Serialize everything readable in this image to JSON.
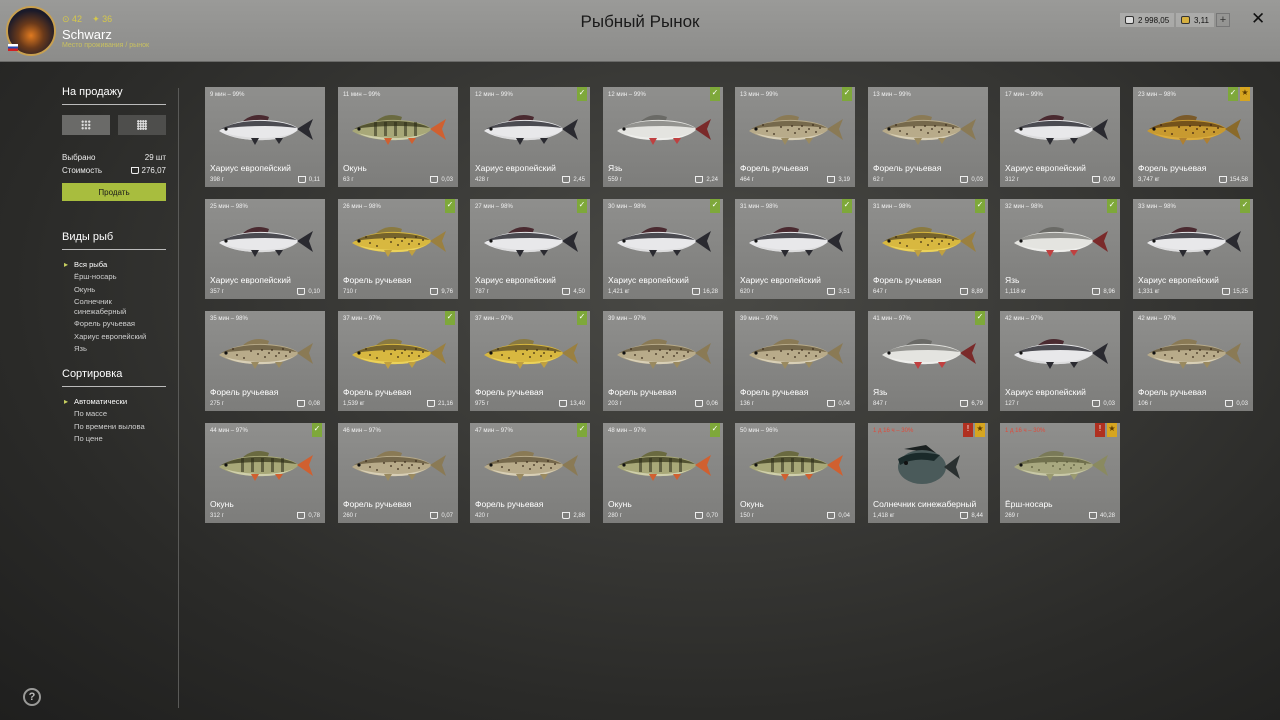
{
  "header": {
    "title": "Рыбный Рынок",
    "stat_level": "42",
    "stat_rank": "36",
    "username": "Schwarz",
    "subline": "Место проживания / рынок",
    "silver": "2 998,05",
    "gold": "3,11",
    "plus": "+",
    "close": "✕"
  },
  "sidebar": {
    "sale_title": "На продажу",
    "selected_label": "Выбрано",
    "selected_value": "29 шт",
    "cost_label": "Стоимость",
    "cost_value": "276,07",
    "sell_label": "Продать",
    "species_title": "Виды рыб",
    "species": [
      "Вся рыба",
      "Ёрш-носарь",
      "Окунь",
      "Солнечник синежаберный",
      "Форель ручьевая",
      "Хариус европейский",
      "Язь"
    ],
    "sort_title": "Сортировка",
    "sorts": [
      "Автоматически",
      "По массе",
      "По времени вылова",
      "По цене"
    ],
    "help": "?"
  },
  "colors": {
    "accent": "#a8bd3e",
    "check_badge": "#7ea83a",
    "star_badge": "#d6a520",
    "warning_badge": "#b03020"
  },
  "cards": [
    {
      "time": "9 мин – 99%",
      "name": "Хариус европейский",
      "weight": "398 г",
      "price": "0,11",
      "badges": [],
      "fish": "grayling"
    },
    {
      "time": "11 мин – 99%",
      "name": "Окунь",
      "weight": "63 г",
      "price": "0,03",
      "badges": [],
      "fish": "perch"
    },
    {
      "time": "12 мин – 99%",
      "name": "Хариус европейский",
      "weight": "428 г",
      "price": "2,45",
      "badges": [
        "check"
      ],
      "fish": "grayling"
    },
    {
      "time": "12 мин – 99%",
      "name": "Язь",
      "weight": "559 г",
      "price": "2,24",
      "badges": [
        "check"
      ],
      "fish": "ide"
    },
    {
      "time": "13 мин – 99%",
      "name": "Форель ручьевая",
      "weight": "464 г",
      "price": "3,19",
      "badges": [
        "check"
      ],
      "fish": "trout"
    },
    {
      "time": "13 мин – 99%",
      "name": "Форель ручьевая",
      "weight": "62 г",
      "price": "0,03",
      "badges": [],
      "fish": "trout"
    },
    {
      "time": "17 мин – 99%",
      "name": "Хариус европейский",
      "weight": "312 г",
      "price": "0,09",
      "badges": [],
      "fish": "grayling"
    },
    {
      "time": "23 мин – 98%",
      "name": "Форель ручьевая",
      "weight": "3,747 кг",
      "price": "154,58",
      "badges": [
        "check",
        "star"
      ],
      "fish": "trout_gold"
    },
    {
      "time": "25 мин – 98%",
      "name": "Хариус европейский",
      "weight": "357 г",
      "price": "0,10",
      "badges": [],
      "fish": "grayling"
    },
    {
      "time": "26 мин – 98%",
      "name": "Форель ручьевая",
      "weight": "710 г",
      "price": "9,76",
      "badges": [
        "check"
      ],
      "fish": "trout_yellow"
    },
    {
      "time": "27 мин – 98%",
      "name": "Хариус европейский",
      "weight": "787 г",
      "price": "4,50",
      "badges": [
        "check"
      ],
      "fish": "grayling"
    },
    {
      "time": "30 мин – 98%",
      "name": "Хариус европейский",
      "weight": "1,421 кг",
      "price": "16,28",
      "badges": [
        "check"
      ],
      "fish": "grayling"
    },
    {
      "time": "31 мин – 98%",
      "name": "Хариус европейский",
      "weight": "620 г",
      "price": "3,51",
      "badges": [
        "check"
      ],
      "fish": "grayling"
    },
    {
      "time": "31 мин – 98%",
      "name": "Форель ручьевая",
      "weight": "647 г",
      "price": "8,89",
      "badges": [
        "check"
      ],
      "fish": "trout_yellow"
    },
    {
      "time": "32 мин – 98%",
      "name": "Язь",
      "weight": "1,118 кг",
      "price": "8,96",
      "badges": [
        "check"
      ],
      "fish": "ide"
    },
    {
      "time": "33 мин – 98%",
      "name": "Хариус европейский",
      "weight": "1,331 кг",
      "price": "15,25",
      "badges": [
        "check"
      ],
      "fish": "grayling"
    },
    {
      "time": "35 мин – 98%",
      "name": "Форель ручьевая",
      "weight": "275 г",
      "price": "0,08",
      "badges": [],
      "fish": "trout"
    },
    {
      "time": "37 мин – 97%",
      "name": "Форель ручьевая",
      "weight": "1,539 кг",
      "price": "21,16",
      "badges": [
        "check"
      ],
      "fish": "trout_yellow"
    },
    {
      "time": "37 мин – 97%",
      "name": "Форель ручьевая",
      "weight": "975 г",
      "price": "13,40",
      "badges": [
        "check"
      ],
      "fish": "trout_yellow"
    },
    {
      "time": "39 мин – 97%",
      "name": "Форель ручьевая",
      "weight": "203 г",
      "price": "0,06",
      "badges": [],
      "fish": "trout"
    },
    {
      "time": "39 мин – 97%",
      "name": "Форель ручьевая",
      "weight": "136 г",
      "price": "0,04",
      "badges": [],
      "fish": "trout"
    },
    {
      "time": "41 мин – 97%",
      "name": "Язь",
      "weight": "847 г",
      "price": "6,79",
      "badges": [
        "check"
      ],
      "fish": "ide"
    },
    {
      "time": "42 мин – 97%",
      "name": "Хариус европейский",
      "weight": "127 г",
      "price": "0,03",
      "badges": [],
      "fish": "grayling"
    },
    {
      "time": "42 мин – 97%",
      "name": "Форель ручьевая",
      "weight": "106 г",
      "price": "0,03",
      "badges": [],
      "fish": "trout"
    },
    {
      "time": "44 мин – 97%",
      "name": "Окунь",
      "weight": "312 г",
      "price": "0,78",
      "badges": [
        "check"
      ],
      "fish": "perch"
    },
    {
      "time": "46 мин – 97%",
      "name": "Форель ручьевая",
      "weight": "260 г",
      "price": "0,07",
      "badges": [],
      "fish": "trout"
    },
    {
      "time": "47 мин – 97%",
      "name": "Форель ручьевая",
      "weight": "420 г",
      "price": "2,88",
      "badges": [
        "check"
      ],
      "fish": "trout"
    },
    {
      "time": "48 мин – 97%",
      "name": "Окунь",
      "weight": "280 г",
      "price": "0,70",
      "badges": [
        "check"
      ],
      "fish": "perch"
    },
    {
      "time": "50 мин – 96%",
      "name": "Окунь",
      "weight": "150 г",
      "price": "0,04",
      "badges": [],
      "fish": "perch"
    },
    {
      "time": "1 д 16 ч – 30%",
      "time_red": true,
      "name": "Солнечник синежаберный",
      "weight": "1,418 кг",
      "price": "8,44",
      "badges": [
        "red",
        "star"
      ],
      "fish": "sunfish"
    },
    {
      "time": "1 д 16 ч – 30%",
      "time_red": true,
      "name": "Ёрш-носарь",
      "weight": "269 г",
      "price": "40,28",
      "badges": [
        "red",
        "star"
      ],
      "fish": "ruffe"
    }
  ]
}
